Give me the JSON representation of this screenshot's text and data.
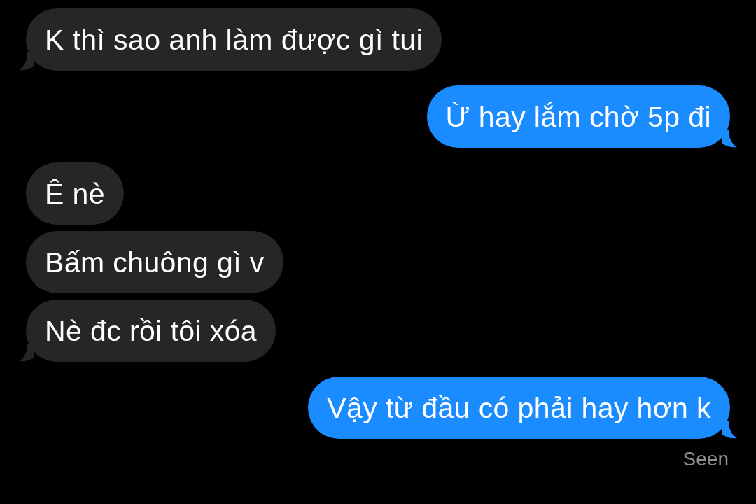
{
  "messages": [
    {
      "kind": "incoming",
      "text": "K thì sao anh làm được gì tui",
      "tail": true
    },
    {
      "kind": "outgoing",
      "text": "Ừ hay lắm chờ 5p đi",
      "tail": true
    },
    {
      "kind": "incoming",
      "text": "Ê nè",
      "tail": false
    },
    {
      "kind": "incoming",
      "text": "Bấm chuông gì v",
      "tail": false
    },
    {
      "kind": "incoming",
      "text": "Nè đc rồi tôi xóa",
      "tail": true
    },
    {
      "kind": "outgoing",
      "text": "Vậy từ đầu có phải hay hơn k",
      "tail": true
    }
  ],
  "status": "Seen"
}
